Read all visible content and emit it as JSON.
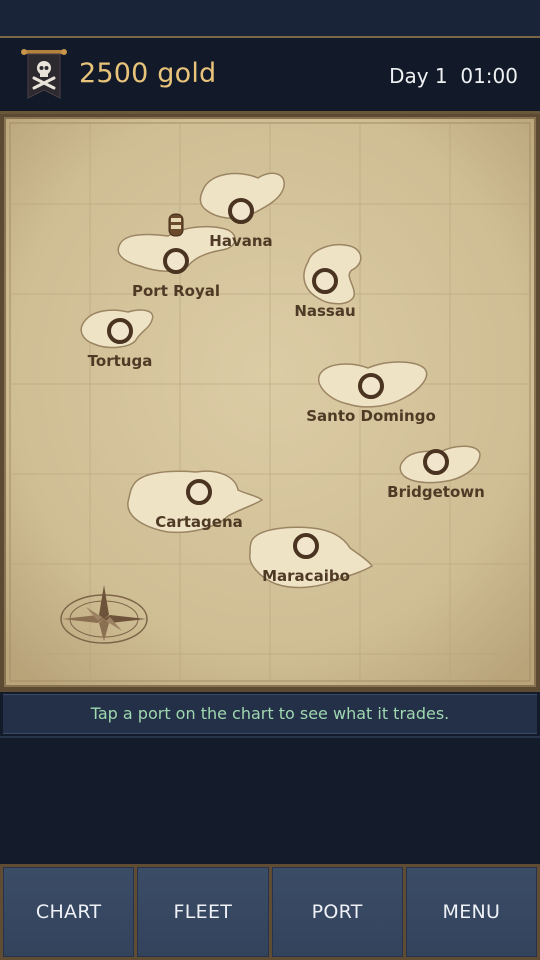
{
  "header": {
    "gold": "2500 gold",
    "day": "Day 1  01:00",
    "banner_icon": "jolly-roger-icon"
  },
  "map": {
    "ports": [
      {
        "name": "Havana"
      },
      {
        "name": "Port Royal"
      },
      {
        "name": "Nassau"
      },
      {
        "name": "Tortuga"
      },
      {
        "name": "Santo Domingo"
      },
      {
        "name": "Bridgetown"
      },
      {
        "name": "Cartagena"
      },
      {
        "name": "Maracaibo"
      }
    ],
    "player_ship_at": "Port Royal"
  },
  "hint": "Tap a port on the chart to see what it trades.",
  "tabs": [
    {
      "label": "CHART"
    },
    {
      "label": "FLEET"
    },
    {
      "label": "PORT"
    },
    {
      "label": "MENU"
    }
  ],
  "colors": {
    "gold_text": "#e8c37a",
    "hint_text": "#9fd7b0",
    "parchment": "#d9c9a3",
    "port_ring": "#4a3421"
  }
}
